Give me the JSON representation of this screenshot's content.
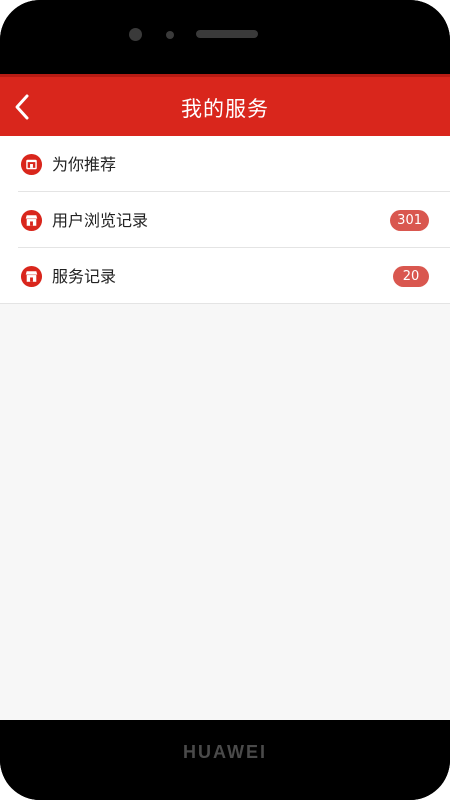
{
  "device": {
    "brand": "HUAWEI"
  },
  "header": {
    "title": "我的服务",
    "back_icon": "chevron-left-icon"
  },
  "list": {
    "items": [
      {
        "label": "为你推荐",
        "icon": "shop-icon"
      },
      {
        "label": "用户浏览记录",
        "icon": "shop-icon",
        "badge": "301"
      },
      {
        "label": "服务记录",
        "icon": "shop-icon",
        "badge": "20"
      }
    ]
  },
  "colors": {
    "accent": "#d9261c",
    "badge": "#d9574f"
  }
}
